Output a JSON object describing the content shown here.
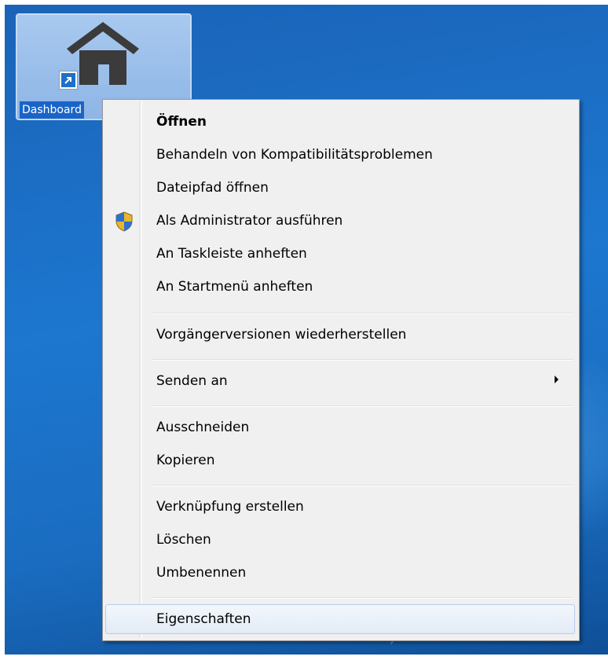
{
  "desktop": {
    "shortcut_label": "Dashboard"
  },
  "context_menu": {
    "items": [
      {
        "label": "Öffnen"
      },
      {
        "label": "Behandeln von Kompatibilitätsproblemen"
      },
      {
        "label": "Dateipfad öffnen"
      },
      {
        "label": "Als Administrator ausführen",
        "icon": "uac-shield-icon"
      },
      {
        "label": "An Taskleiste anheften"
      },
      {
        "label": "An Startmenü anheften"
      },
      {
        "label": "Vorgängerversionen wiederherstellen"
      },
      {
        "label": "Senden an",
        "icon": "submenu-arrow-icon"
      },
      {
        "label": "Ausschneiden"
      },
      {
        "label": "Kopieren"
      },
      {
        "label": "Verknüpfung erstellen"
      },
      {
        "label": "Löschen"
      },
      {
        "label": "Umbenennen"
      },
      {
        "label": "Eigenschaften"
      }
    ],
    "default_item": "Öffnen",
    "highlighted_item": "Eigenschaften"
  },
  "colors": {
    "menu_background": "#f0f0f0",
    "selection_border": "#b7cde9",
    "desktop_blue": "#1d77cf"
  }
}
